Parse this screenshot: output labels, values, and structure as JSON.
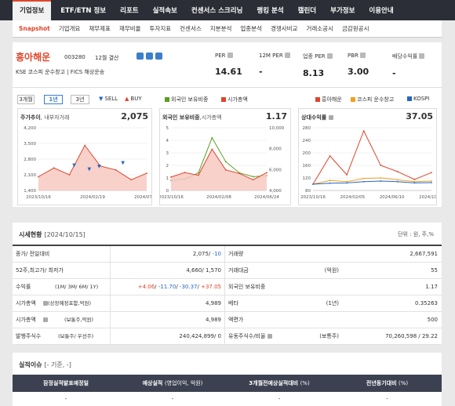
{
  "nav": {
    "tabs": [
      "기업정보",
      "ETF/ETN 정보",
      "리포트",
      "실적속보",
      "컨센서스 스크리닝",
      "랭킹 분석",
      "캘린더",
      "부가정보",
      "이용안내"
    ],
    "active_index": 0
  },
  "subnav": {
    "items": [
      "Snapshot",
      "기업개요",
      "재무제표",
      "재무비율",
      "투자지표",
      "컨센서스",
      "지분분석",
      "업종분석",
      "경쟁사비교",
      "거래소공시",
      "금감원공시"
    ],
    "active_index": 0
  },
  "company": {
    "name": "흥아해운",
    "code": "003280",
    "fiscal": "12월 결산",
    "market": "KSE  코스피 운수창고  |  FICS 해상운송"
  },
  "metrics": [
    {
      "label": "PER",
      "value": "14.61"
    },
    {
      "label": "12M PER",
      "value": "-"
    },
    {
      "label": "업종 PER",
      "value": "8.13"
    },
    {
      "label": "PBR",
      "value": "3.00"
    },
    {
      "label": "배당수익률",
      "value": "-"
    }
  ],
  "period_buttons": [
    "3개월",
    "1년",
    "3년"
  ],
  "active_period": 1,
  "signals": {
    "sell": "SELL",
    "buy": "BUY"
  },
  "legend_mid": {
    "a": "외국인 보유비중",
    "b": "시가총액"
  },
  "legend_right": {
    "a": "흥아해운",
    "b": "코스피 운수창고",
    "c": "KOSPI"
  },
  "colors": {
    "accent": "#e0452b",
    "blue": "#2566c4",
    "green": "#5a9e1f",
    "orange": "#f0a020",
    "dark_nav": "#2b2e36"
  },
  "charts": {
    "price": {
      "title": "주가추이",
      "title_sub": ", 내부자거래",
      "value": "2,075",
      "yticks": [
        "4,200",
        "3,500",
        "2,800",
        "2,100",
        "1,400"
      ],
      "xticks": [
        "2023/10/16",
        "2024/02/19",
        "2024/07/01"
      ]
    },
    "foreign": {
      "title": "외국인 보유비중",
      "title_sub": ",시가총액",
      "value": "1.17",
      "yticks_left": [
        "5",
        "4",
        "3",
        "2",
        "1",
        "0"
      ],
      "yticks_right": [
        "10,000",
        "8,000",
        "6,000",
        "4,000"
      ],
      "xticks": [
        "2023/10/16",
        "2024/02/08",
        "2024/06/24"
      ]
    },
    "relative": {
      "title": "상대수익률",
      "value": "37.05",
      "yticks": [
        "280",
        "240",
        "200",
        "160",
        "120",
        "80"
      ],
      "xticks": [
        "2023/10/16",
        "2024/02/05",
        "2024/06/10",
        "2024/10/07"
      ]
    }
  },
  "chart_data": [
    {
      "type": "area",
      "title": "주가추이",
      "x": [
        "2023/10/16",
        "2023/12",
        "2024/02/19",
        "2024/04",
        "2024/05",
        "2024/07/01",
        "2024/08",
        "2024/10/15"
      ],
      "series": [
        {
          "name": "주가",
          "values": [
            1900,
            2350,
            2000,
            3500,
            2450,
            2250,
            1750,
            2075
          ]
        }
      ],
      "ylim": [
        1200,
        4400
      ]
    },
    {
      "type": "line",
      "title": "외국인 보유비중, 시가총액",
      "x": [
        "2023/10/16",
        "2023/12",
        "2024/02/08",
        "2024/04",
        "2024/05",
        "2024/06/24",
        "2024/08",
        "2024/10/15"
      ],
      "series": [
        {
          "name": "외국인 보유비중",
          "values": [
            0.8,
            0.9,
            1.4,
            4.2,
            2.3,
            1.4,
            1.1,
            1.17
          ]
        },
        {
          "name": "시가총액",
          "values": [
            4500,
            5000,
            4700,
            7600,
            5300,
            4900,
            4200,
            4989
          ]
        }
      ],
      "ylim": [
        0,
        5
      ]
    },
    {
      "type": "line",
      "title": "상대수익률",
      "x": [
        "2023/10/16",
        "2023/12",
        "2024/02/05",
        "2024/04",
        "2024/05",
        "2024/06/10",
        "2024/08",
        "2024/10/07"
      ],
      "series": [
        {
          "name": "흥아해운",
          "values": [
            100,
            190,
            130,
            270,
            160,
            140,
            115,
            137
          ]
        },
        {
          "name": "코스피 운수창고",
          "values": [
            100,
            112,
            108,
            118,
            120,
            114,
            108,
            110
          ]
        },
        {
          "name": "KOSPI",
          "values": [
            100,
            103,
            104,
            108,
            110,
            108,
            104,
            105
          ]
        }
      ],
      "ylim": [
        80,
        280
      ]
    }
  ],
  "quote": {
    "title": "시세현황",
    "date": "[2024/10/15]",
    "unit": "단위 : 원, 주,%",
    "rows": [
      {
        "l1": "종가/ 전일대비",
        "l1s": "",
        "v1a": "2,075/",
        "v1b": "-10",
        "l2": "거래량",
        "l2s": "",
        "v2": "2,667,591"
      },
      {
        "l1": "52주,최고가/ 최저가",
        "l1s": "",
        "v1": "4,660/ 1,570",
        "l2": "거래대금",
        "l2s": "(억원)",
        "v2": "55"
      },
      {
        "l1": "수익률",
        "l1s": "(1M/ 3M/ 6M/ 1Y)",
        "r1": "+4.06",
        "r2": "-11.70",
        "r3": "-30.37",
        "r4": "+37.05",
        "l2": "외국인 보유비중",
        "l2s": "",
        "v2": "1.17"
      },
      {
        "l1": "시가총액",
        "l1s": "(상장예정포함,억원)",
        "v1": "4,989",
        "l2": "베타",
        "l2s": "(1년)",
        "v2": "0.35263"
      },
      {
        "l1": "시가총액",
        "l1s": "(보통주,억원)",
        "v1": "4,989",
        "l2": "액면가",
        "l2s": "",
        "v2": "500"
      },
      {
        "l1": "발행주식수",
        "l1s": "(보통주/ 우선주)",
        "v1": "240,424,899/ 0",
        "l2": "유동주식수/비율",
        "l2s": "(보통주)",
        "v2": "70,260,598 / 29.22"
      }
    ]
  },
  "earnings": {
    "title": "실적이슈",
    "sub": "[- 기준, -]",
    "headers": [
      {
        "a": "잠정실적발표예정일",
        "b": ""
      },
      {
        "a": "예상실적",
        "b": "(영업이익, 억원)"
      },
      {
        "a": "3개월전예상실적대비",
        "b": "(%)"
      },
      {
        "a": "전년동기대비",
        "b": "(%)"
      }
    ],
    "row": [
      "-",
      "-",
      "-",
      "-"
    ]
  }
}
